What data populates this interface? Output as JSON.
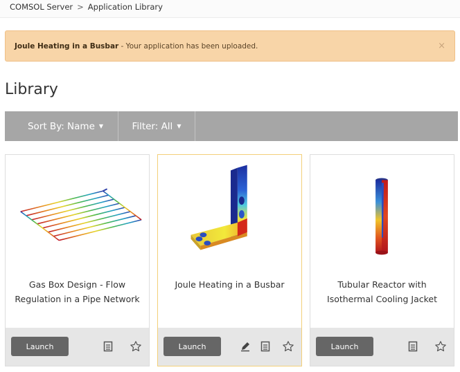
{
  "breadcrumb": {
    "root": "COMSOL Server",
    "separator": ">",
    "current": "Application Library"
  },
  "alert": {
    "app_name": "Joule Heating in a Busbar",
    "message": " - Your application has been uploaded.",
    "close": "×"
  },
  "page": {
    "title": "Library"
  },
  "toolbar": {
    "sort_label": "Sort By: Name",
    "filter_label": "Filter: All"
  },
  "cards": [
    {
      "title": "Gas Box Design - Flow Regulation in a Pipe Network",
      "launch": "Launch"
    },
    {
      "title": "Joule Heating in a Busbar",
      "launch": "Launch"
    },
    {
      "title": "Tubular Reactor with Isothermal Cooling Jacket",
      "launch": "Launch"
    }
  ]
}
